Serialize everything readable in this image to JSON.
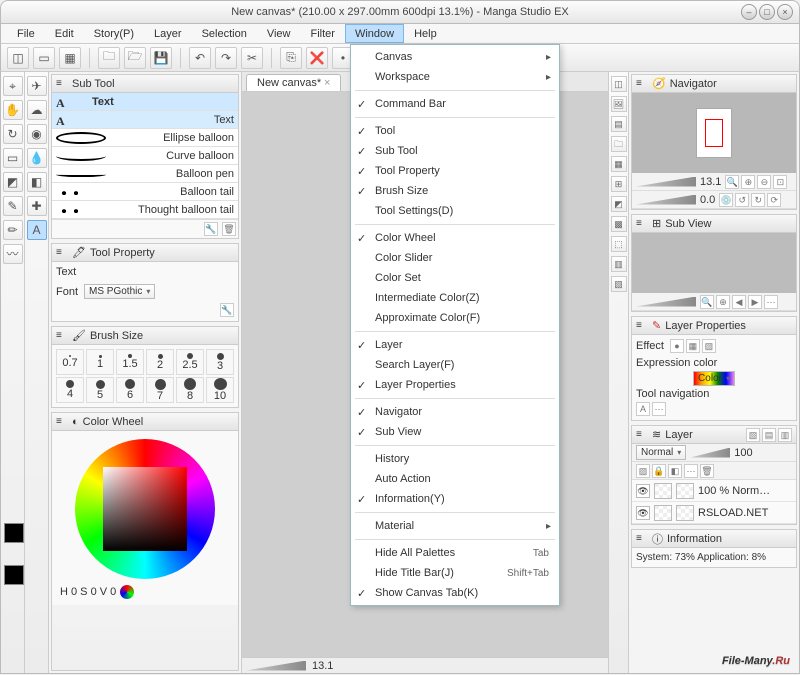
{
  "title": "New canvas* (210.00 x 297.00mm 600dpi 13.1%)  - Manga Studio EX",
  "window_buttons": {
    "min": "–",
    "max": "□",
    "close": "×"
  },
  "menus": [
    "File",
    "Edit",
    "Story(P)",
    "Layer",
    "Selection",
    "View",
    "Filter",
    "Window",
    "Help"
  ],
  "open_menu_index": 7,
  "command_icons": [
    "◫",
    "▭",
    "▦",
    "🗀",
    "🗁",
    "💾",
    "↶",
    "↷",
    "✂",
    "⎘",
    "❌",
    "•",
    "↔",
    "⤢"
  ],
  "tools_left": [
    "⌖",
    "✋",
    "↻",
    "▭",
    "◩",
    "✎",
    "✏",
    "〰",
    "✈",
    "☁",
    "◉",
    "💧",
    "◧",
    "✚",
    "A"
  ],
  "tools_left_active": 14,
  "subtool": {
    "header": "Sub Tool",
    "tab": "Text",
    "items": [
      {
        "label": "Text",
        "sel": true,
        "shape": "text"
      },
      {
        "label": "Ellipse balloon",
        "shape": "ellipse"
      },
      {
        "label": "Curve balloon",
        "shape": "curve"
      },
      {
        "label": "Balloon pen",
        "shape": "line"
      },
      {
        "label": "Balloon tail",
        "shape": "tail"
      },
      {
        "label": "Thought balloon tail",
        "shape": "tail"
      }
    ],
    "footer_icons": [
      "🔧",
      "🗑"
    ]
  },
  "tool_property": {
    "header": "Tool Property",
    "name": "Text",
    "font_label": "Font",
    "font_value": "MS PGothic",
    "wrench": "🔧"
  },
  "brush_size": {
    "header": "Brush Size",
    "row1": [
      "0.7",
      "1",
      "1.5",
      "2",
      "2.5",
      "3"
    ],
    "row2": [
      "4",
      "5",
      "6",
      "7",
      "8",
      "10"
    ]
  },
  "color_wheel": {
    "header": "Color Wheel",
    "hsv": "H 0   S 0   V 0",
    "swatch_main": "#000000",
    "swatch_sub": "#000000"
  },
  "canvas": {
    "tab": "New canvas*",
    "zoom": "13.1",
    "rotation": "0.0"
  },
  "dropdown": [
    {
      "t": "Canvas",
      "arrow": true
    },
    {
      "t": "Workspace",
      "arrow": true
    },
    {
      "sep": true
    },
    {
      "t": "Command Bar",
      "check": true
    },
    {
      "sep": true
    },
    {
      "t": "Tool",
      "check": true
    },
    {
      "t": "Sub Tool",
      "check": true
    },
    {
      "t": "Tool Property",
      "check": true
    },
    {
      "t": "Brush Size",
      "check": true
    },
    {
      "t": "Tool Settings(D)"
    },
    {
      "sep": true
    },
    {
      "t": "Color Wheel",
      "check": true
    },
    {
      "t": "Color Slider"
    },
    {
      "t": "Color Set"
    },
    {
      "t": "Intermediate Color(Z)"
    },
    {
      "t": "Approximate Color(F)"
    },
    {
      "sep": true
    },
    {
      "t": "Layer",
      "check": true
    },
    {
      "t": "Search Layer(F)"
    },
    {
      "t": "Layer Properties",
      "check": true
    },
    {
      "sep": true
    },
    {
      "t": "Navigator",
      "check": true
    },
    {
      "t": "Sub View",
      "check": true
    },
    {
      "sep": true
    },
    {
      "t": "History"
    },
    {
      "t": "Auto Action"
    },
    {
      "t": "Information(Y)",
      "check": true
    },
    {
      "sep": true
    },
    {
      "t": "Material",
      "arrow": true
    },
    {
      "sep": true
    },
    {
      "t": "Hide All Palettes",
      "accel": "Tab"
    },
    {
      "t": "Hide Title Bar(J)",
      "accel": "Shift+Tab"
    },
    {
      "t": "Show Canvas Tab(K)",
      "check": true
    }
  ],
  "navigator": {
    "header": "Navigator",
    "zoom": "13.1",
    "rot": "0.0",
    "zoom_icons": [
      "🔍",
      "⊕",
      "⊖",
      "⊡"
    ],
    "rot_icons": [
      "💿",
      "↺",
      "↻",
      "⟳"
    ]
  },
  "subview": {
    "header": "Sub View",
    "icons": [
      "🔍",
      "⊕",
      "◀",
      "▶",
      "⋯"
    ]
  },
  "layer_props": {
    "header": "Layer Properties",
    "effect_label": "Effect",
    "effect_icons": [
      "●",
      "▦",
      "▨"
    ],
    "expr_label": "Expression color",
    "expr_value": "Color",
    "toolnav_label": "Tool navigation",
    "toolnav_icons": [
      "A",
      "⋯"
    ]
  },
  "layer": {
    "header": "Layer",
    "blend": "Normal",
    "opacity": "100",
    "lock_icons": [
      "▨",
      "🔒",
      "◧",
      "⋯",
      "🗑"
    ],
    "rows": [
      {
        "name": "100 %   Norm…",
        "meta": ""
      },
      {
        "name": "RSLOAD.NET",
        "meta": ""
      }
    ]
  },
  "information": {
    "header": "Information",
    "text": "System: 73%   Application:  8%"
  },
  "dock_right_icons": [
    "◫",
    "🖼",
    "▤",
    "🗀",
    "▦",
    "⊞",
    "◩",
    "▩",
    "⬚",
    "▥",
    "▧"
  ],
  "watermark": {
    "a": "File-Many",
    "b": ".Ru"
  }
}
